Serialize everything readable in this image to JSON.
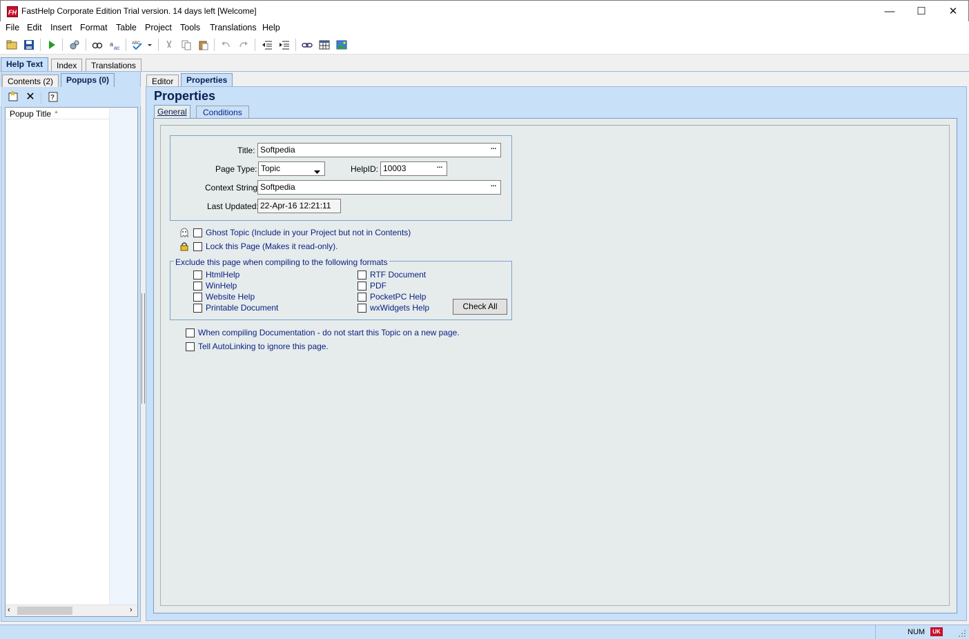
{
  "window": {
    "title": "FastHelp Corporate Edition Trial version. 14 days left [Welcome]",
    "app_icon_text": "FH",
    "minimize": "—",
    "maximize": "☐",
    "close": "✕"
  },
  "menu": [
    "File",
    "Edit",
    "Insert",
    "Format",
    "Table",
    "Project",
    "Tools",
    "Translations",
    "Help"
  ],
  "toolbar_icons": [
    "open-icon",
    "save-icon",
    "run-icon",
    "compile-icon",
    "spellcheck-icon",
    "find-replace-icon",
    "spell-abc-icon",
    "cut-icon",
    "copy-icon",
    "paste-icon",
    "undo-icon",
    "redo-icon",
    "outdent-icon",
    "indent-icon",
    "link-icon",
    "table-icon",
    "image-icon"
  ],
  "top_tabs": [
    "Help Text",
    "Index",
    "Translations"
  ],
  "left_tabs": [
    "Contents (2)",
    "Popups (0)"
  ],
  "list": {
    "column": "Popup Title",
    "sort_glyph": "▲"
  },
  "right_tabs": [
    "Editor",
    "Properties"
  ],
  "heading": "Properties",
  "sub_tabs": [
    "General",
    "Conditions"
  ],
  "form": {
    "title_label": "Title:",
    "title_value": "Softpedia",
    "page_type_label": "Page Type:",
    "page_type_value": "Topic",
    "helpid_label": "HelpID:",
    "helpid_value": "10003",
    "context_label": "Context String:",
    "context_value": "Softpedia",
    "updated_label": "Last Updated:",
    "updated_value": "22-Apr-16 12:21:11",
    "ellipsis": "..."
  },
  "options": {
    "ghost": "Ghost Topic (Include in your Project but not in Contents)",
    "lock": "Lock this Page (Makes it read-only)."
  },
  "exclude": {
    "legend": "Exclude this page when compiling to the following formats",
    "left": [
      "HtmlHelp",
      "WinHelp",
      "Website Help",
      "Printable Document"
    ],
    "right": [
      "RTF Document",
      "PDF",
      "PocketPC Help",
      "wxWidgets Help"
    ],
    "check_all": "Check All"
  },
  "extra": {
    "doc": "When compiling Documentation - do not start this Topic on a new page.",
    "autolink": "Tell AutoLinking to ignore this page."
  },
  "status": {
    "num": "NUM",
    "flag": "UK"
  },
  "colors": {
    "accent": "#c8e0f8",
    "label_blue": "#0a1e80",
    "brand": "#c8102e"
  }
}
